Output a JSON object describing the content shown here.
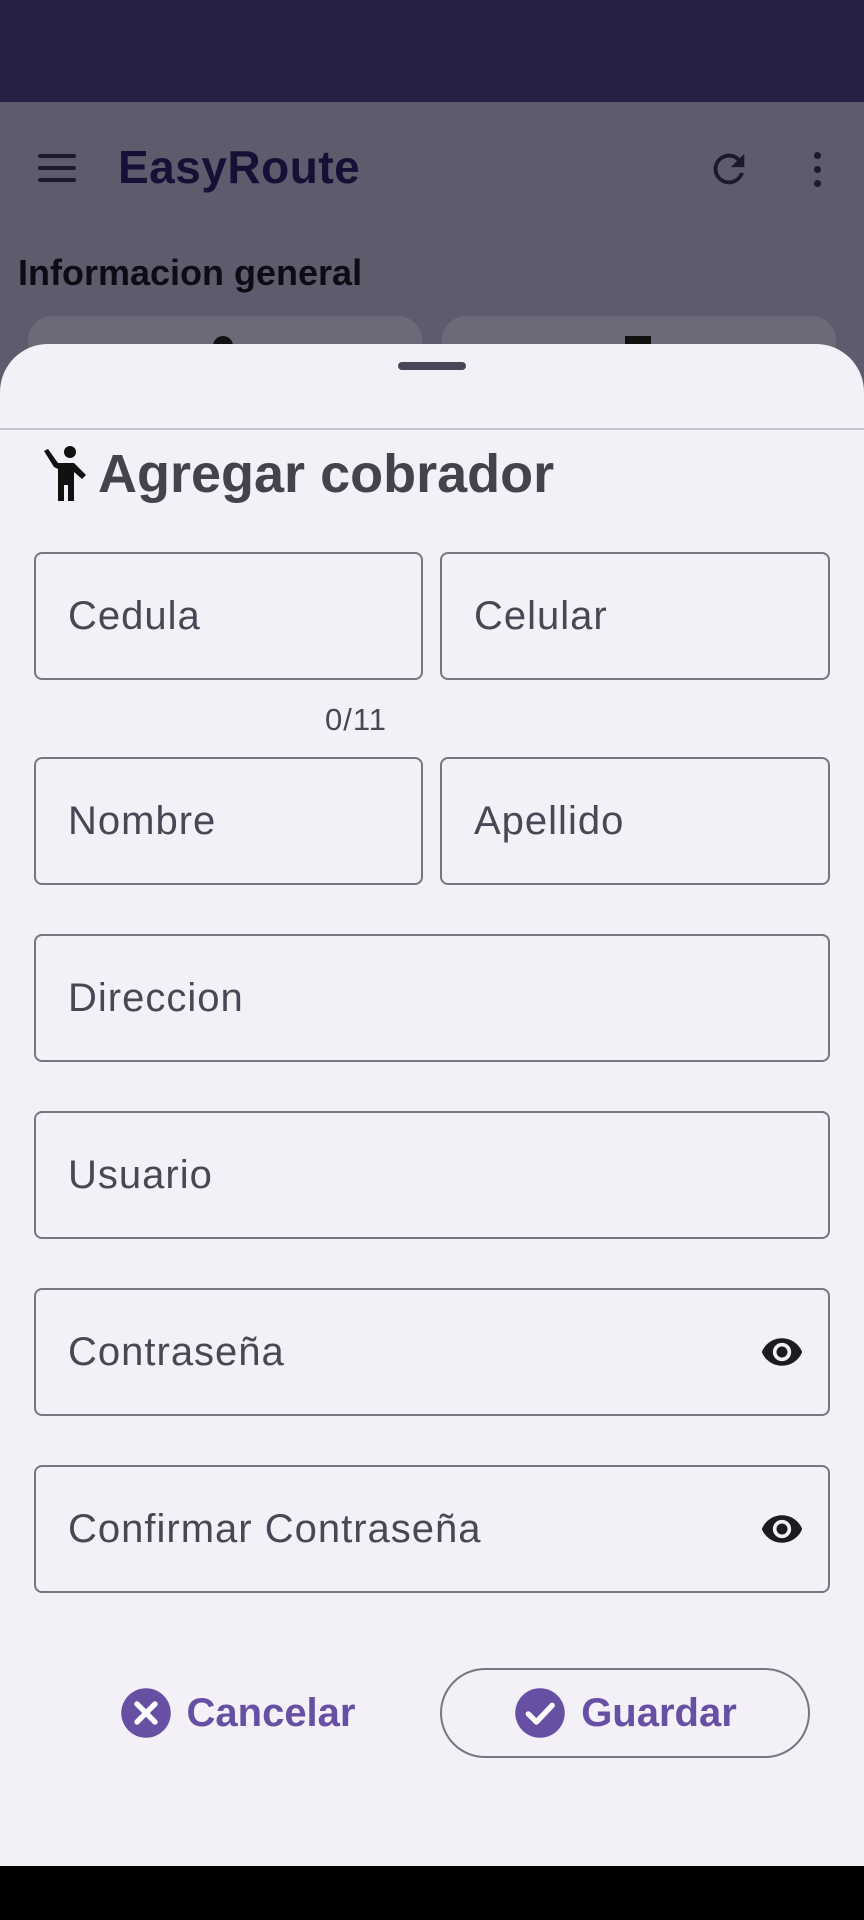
{
  "app": {
    "title": "EasyRoute",
    "section_title": "Informacion general"
  },
  "sheet": {
    "title": "Agregar cobrador",
    "fields": {
      "cedula": {
        "placeholder": "Cedula",
        "counter": "0/11"
      },
      "celular": {
        "placeholder": "Celular"
      },
      "nombre": {
        "placeholder": "Nombre"
      },
      "apellido": {
        "placeholder": "Apellido"
      },
      "direccion": {
        "placeholder": "Direccion"
      },
      "usuario": {
        "placeholder": "Usuario"
      },
      "contrasena": {
        "placeholder": "Contraseña"
      },
      "confirmar": {
        "placeholder": "Confirmar Contraseña"
      }
    },
    "buttons": {
      "cancel": "Cancelar",
      "save": "Guardar"
    }
  },
  "icons": {
    "menu": "menu-icon",
    "refresh": "refresh-icon",
    "more": "more-vert-icon",
    "person": "person-raised-hand-icon",
    "eye": "eye-icon",
    "cancel": "close-circle-icon",
    "save": "check-circle-icon"
  },
  "colors": {
    "status_bar": "#272244",
    "scrim_background": "#5f5b6c",
    "sheet_background": "#f3f0f7",
    "accent": "#6750a4",
    "outline": "#79757f"
  }
}
